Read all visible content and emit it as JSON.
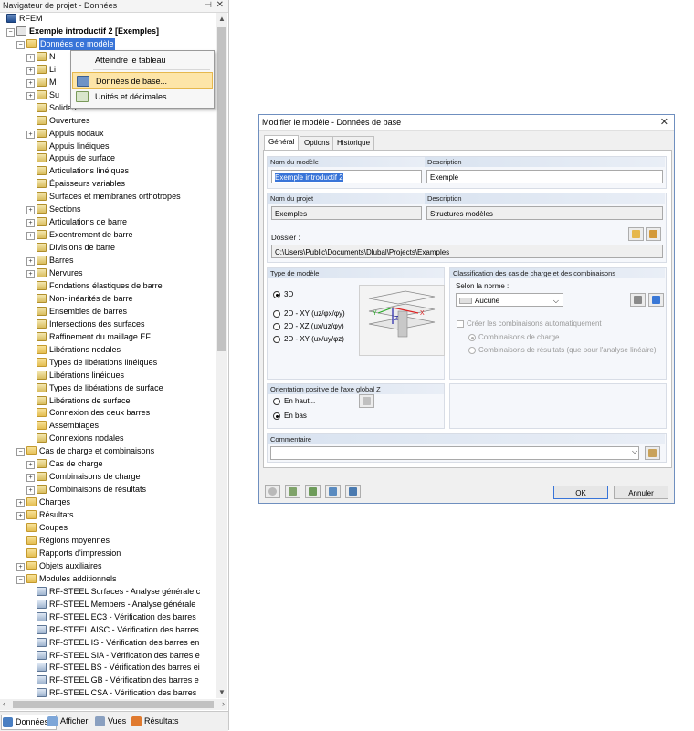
{
  "navigator": {
    "title": "Navigateur de projet - Données",
    "pin_icon": "pin-icon",
    "close_icon": "close-icon",
    "tree": [
      {
        "label": "RFEM",
        "depth": 0,
        "exp": "",
        "icon": "root",
        "bold": false,
        "selected": false
      },
      {
        "label": "Exemple introductif 2 [Exemples]",
        "depth": 1,
        "exp": "−",
        "icon": "proj",
        "bold": true,
        "selected": false
      },
      {
        "label": "Données de modèle",
        "depth": 2,
        "exp": "−",
        "icon": "folder",
        "bold": false,
        "selected": true
      },
      {
        "label": "N",
        "depth": 3,
        "exp": "+",
        "icon": "item",
        "bold": false,
        "selected": false
      },
      {
        "label": "Li",
        "depth": 3,
        "exp": "+",
        "icon": "item",
        "bold": false,
        "selected": false
      },
      {
        "label": "M",
        "depth": 3,
        "exp": "+",
        "icon": "item",
        "bold": false,
        "selected": false
      },
      {
        "label": "Su",
        "depth": 3,
        "exp": "+",
        "icon": "item",
        "bold": false,
        "selected": false
      },
      {
        "label": "Solides",
        "depth": 3,
        "exp": "",
        "icon": "item",
        "bold": false,
        "selected": false
      },
      {
        "label": "Ouvertures",
        "depth": 3,
        "exp": "",
        "icon": "item",
        "bold": false,
        "selected": false
      },
      {
        "label": "Appuis nodaux",
        "depth": 3,
        "exp": "+",
        "icon": "item",
        "bold": false,
        "selected": false
      },
      {
        "label": "Appuis linéiques",
        "depth": 3,
        "exp": "",
        "icon": "item",
        "bold": false,
        "selected": false
      },
      {
        "label": "Appuis de surface",
        "depth": 3,
        "exp": "",
        "icon": "item",
        "bold": false,
        "selected": false
      },
      {
        "label": "Articulations linéiques",
        "depth": 3,
        "exp": "",
        "icon": "item",
        "bold": false,
        "selected": false
      },
      {
        "label": "Épaisseurs variables",
        "depth": 3,
        "exp": "",
        "icon": "item",
        "bold": false,
        "selected": false
      },
      {
        "label": "Surfaces et membranes orthotropes",
        "depth": 3,
        "exp": "",
        "icon": "item",
        "bold": false,
        "selected": false
      },
      {
        "label": "Sections",
        "depth": 3,
        "exp": "+",
        "icon": "item",
        "bold": false,
        "selected": false
      },
      {
        "label": "Articulations de barre",
        "depth": 3,
        "exp": "+",
        "icon": "item",
        "bold": false,
        "selected": false
      },
      {
        "label": "Excentrement de barre",
        "depth": 3,
        "exp": "+",
        "icon": "item",
        "bold": false,
        "selected": false
      },
      {
        "label": "Divisions de barre",
        "depth": 3,
        "exp": "",
        "icon": "item",
        "bold": false,
        "selected": false
      },
      {
        "label": "Barres",
        "depth": 3,
        "exp": "+",
        "icon": "item",
        "bold": false,
        "selected": false
      },
      {
        "label": "Nervures",
        "depth": 3,
        "exp": "+",
        "icon": "item",
        "bold": false,
        "selected": false
      },
      {
        "label": "Fondations élastiques de barre",
        "depth": 3,
        "exp": "",
        "icon": "item",
        "bold": false,
        "selected": false
      },
      {
        "label": "Non-linéarités de barre",
        "depth": 3,
        "exp": "",
        "icon": "item",
        "bold": false,
        "selected": false
      },
      {
        "label": "Ensembles de barres",
        "depth": 3,
        "exp": "",
        "icon": "item",
        "bold": false,
        "selected": false
      },
      {
        "label": "Intersections des surfaces",
        "depth": 3,
        "exp": "",
        "icon": "item",
        "bold": false,
        "selected": false
      },
      {
        "label": "Raffinement du maillage EF",
        "depth": 3,
        "exp": "",
        "icon": "item",
        "bold": false,
        "selected": false
      },
      {
        "label": "Libérations nodales",
        "depth": 3,
        "exp": "",
        "icon": "folder",
        "bold": false,
        "selected": false
      },
      {
        "label": "Types de libérations linéiques",
        "depth": 3,
        "exp": "",
        "icon": "folder",
        "bold": false,
        "selected": false
      },
      {
        "label": "Libérations linéiques",
        "depth": 3,
        "exp": "",
        "icon": "item",
        "bold": false,
        "selected": false
      },
      {
        "label": "Types de libérations de surface",
        "depth": 3,
        "exp": "",
        "icon": "item",
        "bold": false,
        "selected": false
      },
      {
        "label": "Libérations de surface",
        "depth": 3,
        "exp": "",
        "icon": "item",
        "bold": false,
        "selected": false
      },
      {
        "label": "Connexion des deux barres",
        "depth": 3,
        "exp": "",
        "icon": "folder",
        "bold": false,
        "selected": false
      },
      {
        "label": "Assemblages",
        "depth": 3,
        "exp": "",
        "icon": "folder",
        "bold": false,
        "selected": false
      },
      {
        "label": "Connexions nodales",
        "depth": 3,
        "exp": "",
        "icon": "item",
        "bold": false,
        "selected": false
      },
      {
        "label": "Cas de charge et combinaisons",
        "depth": 2,
        "exp": "−",
        "icon": "folder",
        "bold": false,
        "selected": false
      },
      {
        "label": "Cas de charge",
        "depth": 3,
        "exp": "+",
        "icon": "item",
        "bold": false,
        "selected": false
      },
      {
        "label": "Combinaisons de charge",
        "depth": 3,
        "exp": "+",
        "icon": "item",
        "bold": false,
        "selected": false
      },
      {
        "label": "Combinaisons de résultats",
        "depth": 3,
        "exp": "+",
        "icon": "item",
        "bold": false,
        "selected": false
      },
      {
        "label": "Charges",
        "depth": 2,
        "exp": "+",
        "icon": "folder",
        "bold": false,
        "selected": false
      },
      {
        "label": "Résultats",
        "depth": 2,
        "exp": "+",
        "icon": "folder",
        "bold": false,
        "selected": false
      },
      {
        "label": "Coupes",
        "depth": 2,
        "exp": "",
        "icon": "folder",
        "bold": false,
        "selected": false
      },
      {
        "label": "Régions moyennes",
        "depth": 2,
        "exp": "",
        "icon": "folder",
        "bold": false,
        "selected": false
      },
      {
        "label": "Rapports d'impression",
        "depth": 2,
        "exp": "",
        "icon": "folder",
        "bold": false,
        "selected": false
      },
      {
        "label": "Objets auxiliaires",
        "depth": 2,
        "exp": "+",
        "icon": "folder",
        "bold": false,
        "selected": false
      },
      {
        "label": "Modules additionnels",
        "depth": 2,
        "exp": "−",
        "icon": "folder",
        "bold": false,
        "selected": false
      },
      {
        "label": "RF-STEEL Surfaces - Analyse générale c",
        "depth": 3,
        "exp": "",
        "icon": "mod",
        "bold": false,
        "selected": false
      },
      {
        "label": "RF-STEEL Members - Analyse générale",
        "depth": 3,
        "exp": "",
        "icon": "mod",
        "bold": false,
        "selected": false
      },
      {
        "label": "RF-STEEL EC3 - Vérification des barres",
        "depth": 3,
        "exp": "",
        "icon": "mod",
        "bold": false,
        "selected": false
      },
      {
        "label": "RF-STEEL AISC - Vérification des barres",
        "depth": 3,
        "exp": "",
        "icon": "mod",
        "bold": false,
        "selected": false
      },
      {
        "label": "RF-STEEL IS - Vérification des barres en",
        "depth": 3,
        "exp": "",
        "icon": "mod",
        "bold": false,
        "selected": false
      },
      {
        "label": "RF-STEEL SIA - Vérification des barres e",
        "depth": 3,
        "exp": "",
        "icon": "mod",
        "bold": false,
        "selected": false
      },
      {
        "label": "RF-STEEL BS - Vérification des barres ei",
        "depth": 3,
        "exp": "",
        "icon": "mod",
        "bold": false,
        "selected": false
      },
      {
        "label": "RF-STEEL GB - Vérification des barres e",
        "depth": 3,
        "exp": "",
        "icon": "mod",
        "bold": false,
        "selected": false
      },
      {
        "label": "RF-STEEL CSA - Vérification des barres",
        "depth": 3,
        "exp": "",
        "icon": "mod",
        "bold": false,
        "selected": false
      }
    ],
    "tabs": [
      {
        "label": "Données",
        "icon": "data-icon",
        "active": true
      },
      {
        "label": "Afficher",
        "icon": "display-icon",
        "active": false
      },
      {
        "label": "Vues",
        "icon": "views-icon",
        "active": false
      },
      {
        "label": "Résultats",
        "icon": "results-icon",
        "active": false
      }
    ]
  },
  "context_menu": {
    "items": [
      {
        "label": "Atteindre le tableau",
        "icon": "",
        "highlighted": false
      },
      {
        "label": "Données de base...",
        "icon": "basic-data-icon",
        "highlighted": true
      },
      {
        "label": "Unités et décimales...",
        "icon": "units-icon",
        "highlighted": false
      }
    ]
  },
  "dialog": {
    "title": "Modifier le modèle - Données de base",
    "tabs": [
      "Général",
      "Options",
      "Historique"
    ],
    "model_name_label": "Nom du modèle",
    "model_name_value": "Exemple introductif 2",
    "model_desc_label": "Description",
    "model_desc_value": "Exemple",
    "project_name_label": "Nom du projet",
    "project_name_value": "Exemples",
    "project_desc_label": "Description",
    "project_desc_value": "Structures modèles",
    "folder_label": "Dossier :",
    "folder_value": "C:\\Users\\Public\\Documents\\Dlubal\\Projects\\Examples",
    "model_type_title": "Type de modèle",
    "model_types": [
      {
        "label": "3D",
        "checked": true
      },
      {
        "label": "2D - XY (uz/φx/φy)",
        "checked": false
      },
      {
        "label": "2D - XZ (ux/uz/φy)",
        "checked": false
      },
      {
        "label": "2D - XY (ux/uy/φz)",
        "checked": false
      }
    ],
    "classification_title": "Classification des cas de charge et des combinaisons",
    "norm_label": "Selon la norme :",
    "norm_value": "Aucune",
    "auto_comb_label": "Créer les combinaisons automatiquement",
    "comb_options": [
      {
        "label": "Combinaisons de charge",
        "checked": true
      },
      {
        "label": "Combinaisons de résultats (que pour l'analyse linéaire)",
        "checked": false
      }
    ],
    "orientation_title": "Orientation positive de l'axe global Z",
    "orientation_options": [
      {
        "label": "En haut...",
        "checked": false
      },
      {
        "label": "En bas",
        "checked": true
      }
    ],
    "comment_title": "Commentaire",
    "comment_value": "",
    "ok_label": "OK",
    "cancel_label": "Annuler",
    "axis_labels": {
      "x": "X",
      "y": "Y",
      "z": "Z"
    }
  },
  "colors": {
    "selection": "#3874d8",
    "menu_highlight": "#fde5a8",
    "dialog_border": "#6f8fbf"
  }
}
